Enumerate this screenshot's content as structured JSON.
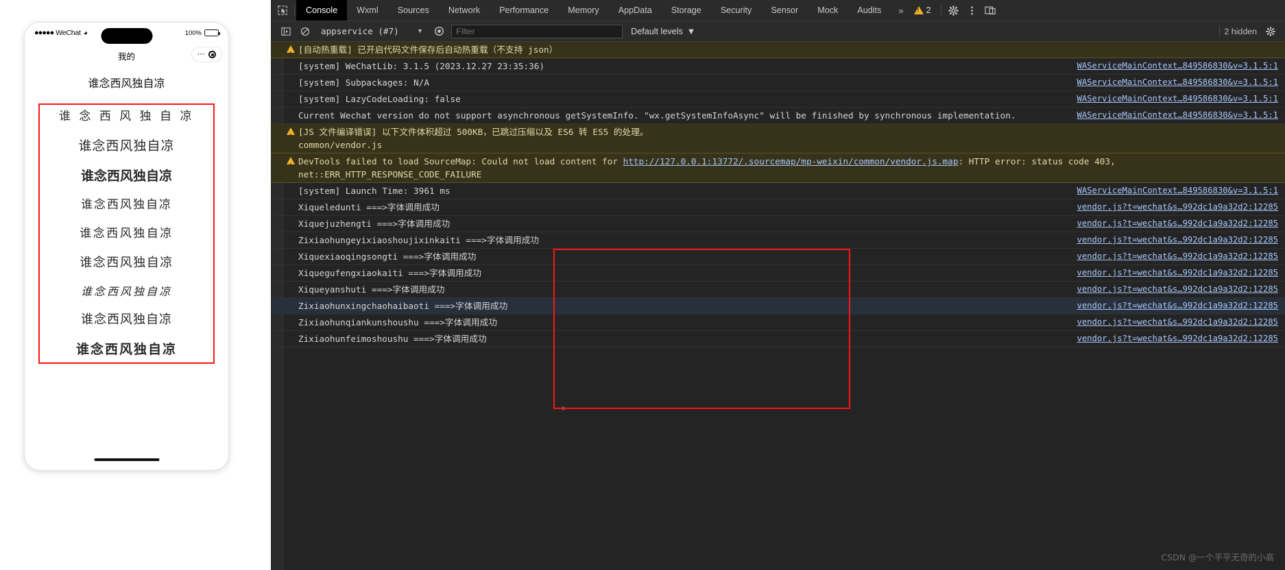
{
  "simulator": {
    "status_bar": {
      "dots": "●●●●●",
      "carrier": "WeChat",
      "wifi_icon": "wifi-icon",
      "battery_percent": "100%"
    },
    "nav_title": "我的",
    "capsule": {
      "menu_icon": "more-dots-icon",
      "close_icon": "target-circle-icon"
    },
    "page_heading": "谁念西风独自凉",
    "font_samples": [
      "谁 念 西 风 独 自 凉",
      "谁念西风独自凉",
      "谁念西风独自凉",
      "谁念西风独自凉",
      "谁念西风独自凉",
      "谁念西风独自凉",
      "谁念西风独自凉",
      "谁念西风独自凉",
      "谁念西风独自凉"
    ],
    "highlight_color": "#ff1414"
  },
  "devtools": {
    "inspect_icon": "inspect-cursor-icon",
    "tabs": [
      {
        "label": "Console",
        "active": true
      },
      {
        "label": "Wxml",
        "active": false
      },
      {
        "label": "Sources",
        "active": false
      },
      {
        "label": "Network",
        "active": false
      },
      {
        "label": "Performance",
        "active": false
      },
      {
        "label": "Memory",
        "active": false
      },
      {
        "label": "AppData",
        "active": false
      },
      {
        "label": "Storage",
        "active": false
      },
      {
        "label": "Security",
        "active": false
      },
      {
        "label": "Sensor",
        "active": false
      },
      {
        "label": "Mock",
        "active": false
      },
      {
        "label": "Audits",
        "active": false
      }
    ],
    "more_tabs_icon": "»",
    "warning_badge": {
      "icon": "warning-triangle-icon",
      "count": "2"
    },
    "settings_icon": "gear-icon",
    "kebab_icon": "more-vertical-icon",
    "dock_icon": "dock-panel-icon",
    "toolbar": {
      "sidebar_icon": "console-sidebar-icon",
      "clear_icon": "clear-console-icon",
      "context": "appservice (#7)",
      "context_caret": "▼",
      "eye_icon": "live-expression-icon",
      "filter_placeholder": "Filter",
      "filter_value": "",
      "levels_label": "Default levels",
      "levels_caret": "▼",
      "hidden_label": "2 hidden",
      "settings_icon": "console-settings-icon"
    },
    "logs": [
      {
        "level": "warning",
        "text": "[自动热重载] 已开启代码文件保存后自动热重载（不支持 json）",
        "link": ""
      },
      {
        "level": "info",
        "text": "[system] WeChatLib: 3.1.5 (2023.12.27 23:35:36)",
        "link": "WAServiceMainContext…849586830&v=3.1.5:1"
      },
      {
        "level": "info",
        "text": "[system] Subpackages: N/A",
        "link": "WAServiceMainContext…849586830&v=3.1.5:1"
      },
      {
        "level": "info",
        "text": "[system] LazyCodeLoading: false",
        "link": "WAServiceMainContext…849586830&v=3.1.5:1"
      },
      {
        "level": "info",
        "text": "Current Wechat version do not support asynchronous getSystemInfo. \"wx.getSystemInfoAsync\" will be finished by synchronous implementation.",
        "link": "WAServiceMainContext…849586830&v=3.1.5:1"
      },
      {
        "level": "warning",
        "text": "[JS 文件编译错误] 以下文件体积超过 500KB，已跳过压缩以及 ES6 转 ES5 的处理。\ncommon/vendor.js",
        "link": ""
      },
      {
        "level": "warning",
        "text": "DevTools failed to load SourceMap: Could not load content for ",
        "link_inline": "http://127.0.0.1:13772/.sourcemap/mp-weixin/common/vendor.js.map",
        "text_after": ": HTTP error: status code 403, net::ERR_HTTP_RESPONSE_CODE_FAILURE",
        "link": ""
      },
      {
        "level": "info",
        "text": "[system] Launch Time: 3961 ms",
        "link": "WAServiceMainContext…849586830&v=3.1.5:1"
      },
      {
        "level": "info",
        "text": "Xiqueledunti ===>字体调用成功",
        "link": "vendor.js?t=wechat&s…992dc1a9a32d2:12285"
      },
      {
        "level": "info",
        "text": "Xiquejuzhengti ===>字体调用成功",
        "link": "vendor.js?t=wechat&s…992dc1a9a32d2:12285"
      },
      {
        "level": "info",
        "text": "Zixiaohungeyixiaoshoujixinkaiti ===>字体调用成功",
        "link": "vendor.js?t=wechat&s…992dc1a9a32d2:12285"
      },
      {
        "level": "info",
        "text": "Xiquexiaoqingsongti ===>字体调用成功",
        "link": "vendor.js?t=wechat&s…992dc1a9a32d2:12285"
      },
      {
        "level": "info",
        "text": "Xiquegufengxiaokaiti ===>字体调用成功",
        "link": "vendor.js?t=wechat&s…992dc1a9a32d2:12285"
      },
      {
        "level": "info",
        "text": "Xiqueyanshuti ===>字体调用成功",
        "link": "vendor.js?t=wechat&s…992dc1a9a32d2:12285"
      },
      {
        "level": "info",
        "selected": true,
        "text": "Zixiaohunxingchaohaibaoti ===>字体调用成功",
        "link": "vendor.js?t=wechat&s…992dc1a9a32d2:12285"
      },
      {
        "level": "info",
        "text": "Zixiaohunqiankunshoushu ===>字体调用成功",
        "link": "vendor.js?t=wechat&s…992dc1a9a32d2:12285"
      },
      {
        "level": "info",
        "text": "Zixiaohunfeimoshoushu ===>字体调用成功",
        "link": "vendor.js?t=wechat&s…992dc1a9a32d2:12285"
      }
    ],
    "prompt": ">",
    "highlight_color": "#ff1414"
  },
  "watermark": "CSDN @一个平平无奇的小高"
}
